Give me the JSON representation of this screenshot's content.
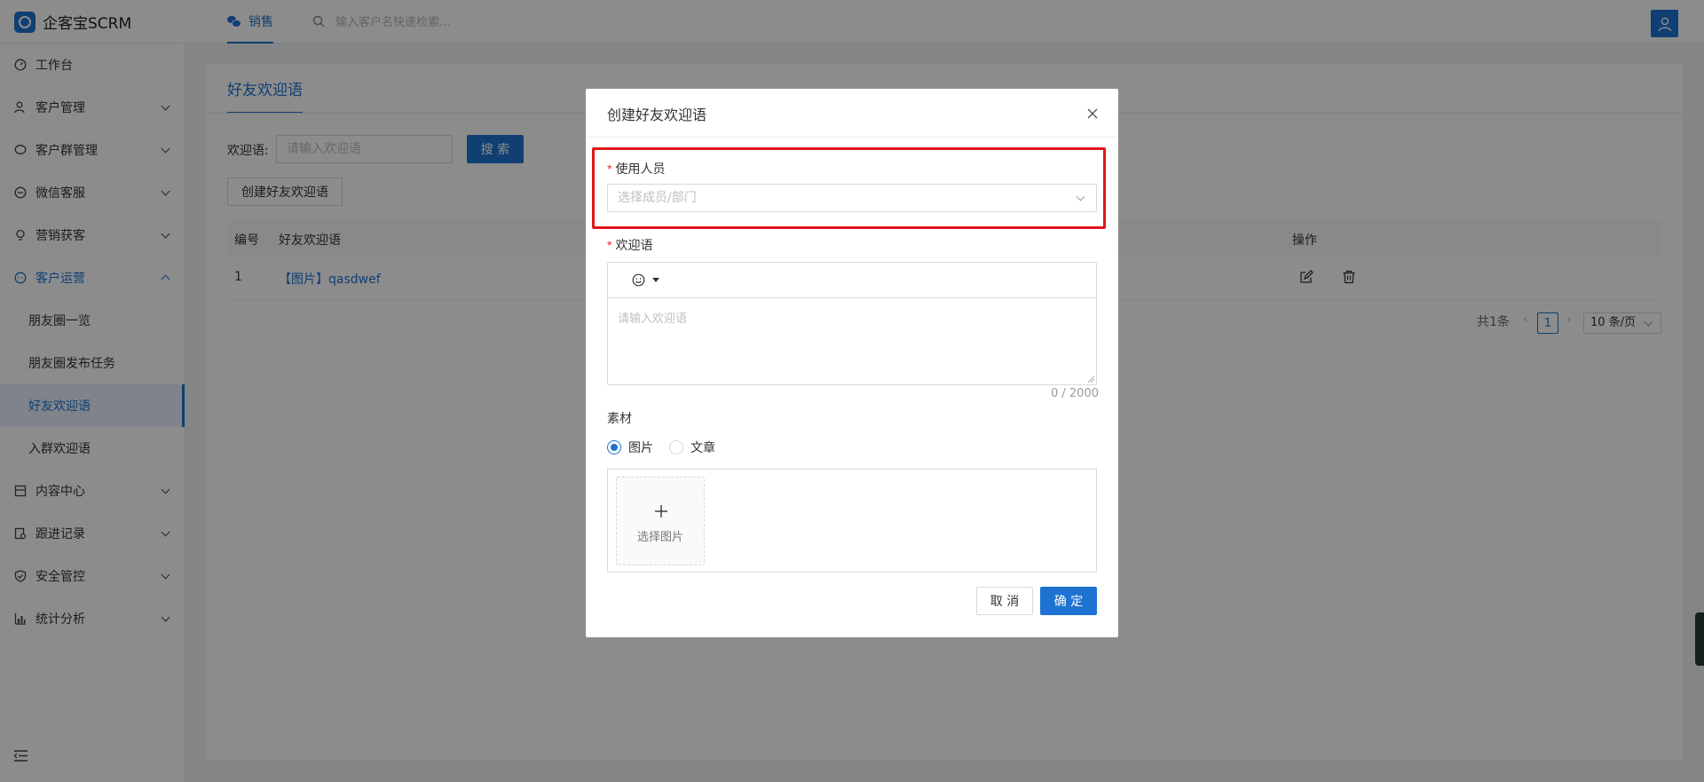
{
  "app": {
    "brand": "企客宝SCRM"
  },
  "topbar": {
    "tab_label": "销售",
    "search_placeholder": "输入客户名快速检索..."
  },
  "sidebar": {
    "items": [
      {
        "label": "工作台"
      },
      {
        "label": "客户管理"
      },
      {
        "label": "客户群管理"
      },
      {
        "label": "微信客服"
      },
      {
        "label": "营销获客"
      },
      {
        "label": "客户运营"
      },
      {
        "label": "内容中心"
      },
      {
        "label": "跟进记录"
      },
      {
        "label": "安全管控"
      },
      {
        "label": "统计分析"
      }
    ],
    "subitems": [
      {
        "label": "朋友圈一览"
      },
      {
        "label": "朋友圈发布任务"
      },
      {
        "label": "好友欢迎语"
      },
      {
        "label": "入群欢迎语"
      }
    ]
  },
  "main": {
    "tab": "好友欢迎语",
    "filter_label": "欢迎语:",
    "filter_placeholder": "请输入欢迎语",
    "search_button": "搜 索",
    "create_button": "创建好友欢迎语",
    "table": {
      "columns": [
        "编号",
        "好友欢迎语",
        "操作"
      ],
      "rows": [
        {
          "id": "1",
          "content": "【图片】qasdwef"
        }
      ]
    },
    "pagination": {
      "total": "共1条",
      "current": "1",
      "page_size": "10 条/页"
    }
  },
  "modal": {
    "title": "创建好友欢迎语",
    "user_label": "使用人员",
    "user_placeholder": "选择成员/部门",
    "welcome_label": "欢迎语",
    "welcome_placeholder": "请输入欢迎语",
    "counter": "0 / 2000",
    "material_label": "素材",
    "material_options": [
      "图片",
      "文章"
    ],
    "material_selected": "图片",
    "upload_text": "选择图片",
    "cancel": "取 消",
    "confirm": "确 定",
    "required_mark": "*"
  }
}
